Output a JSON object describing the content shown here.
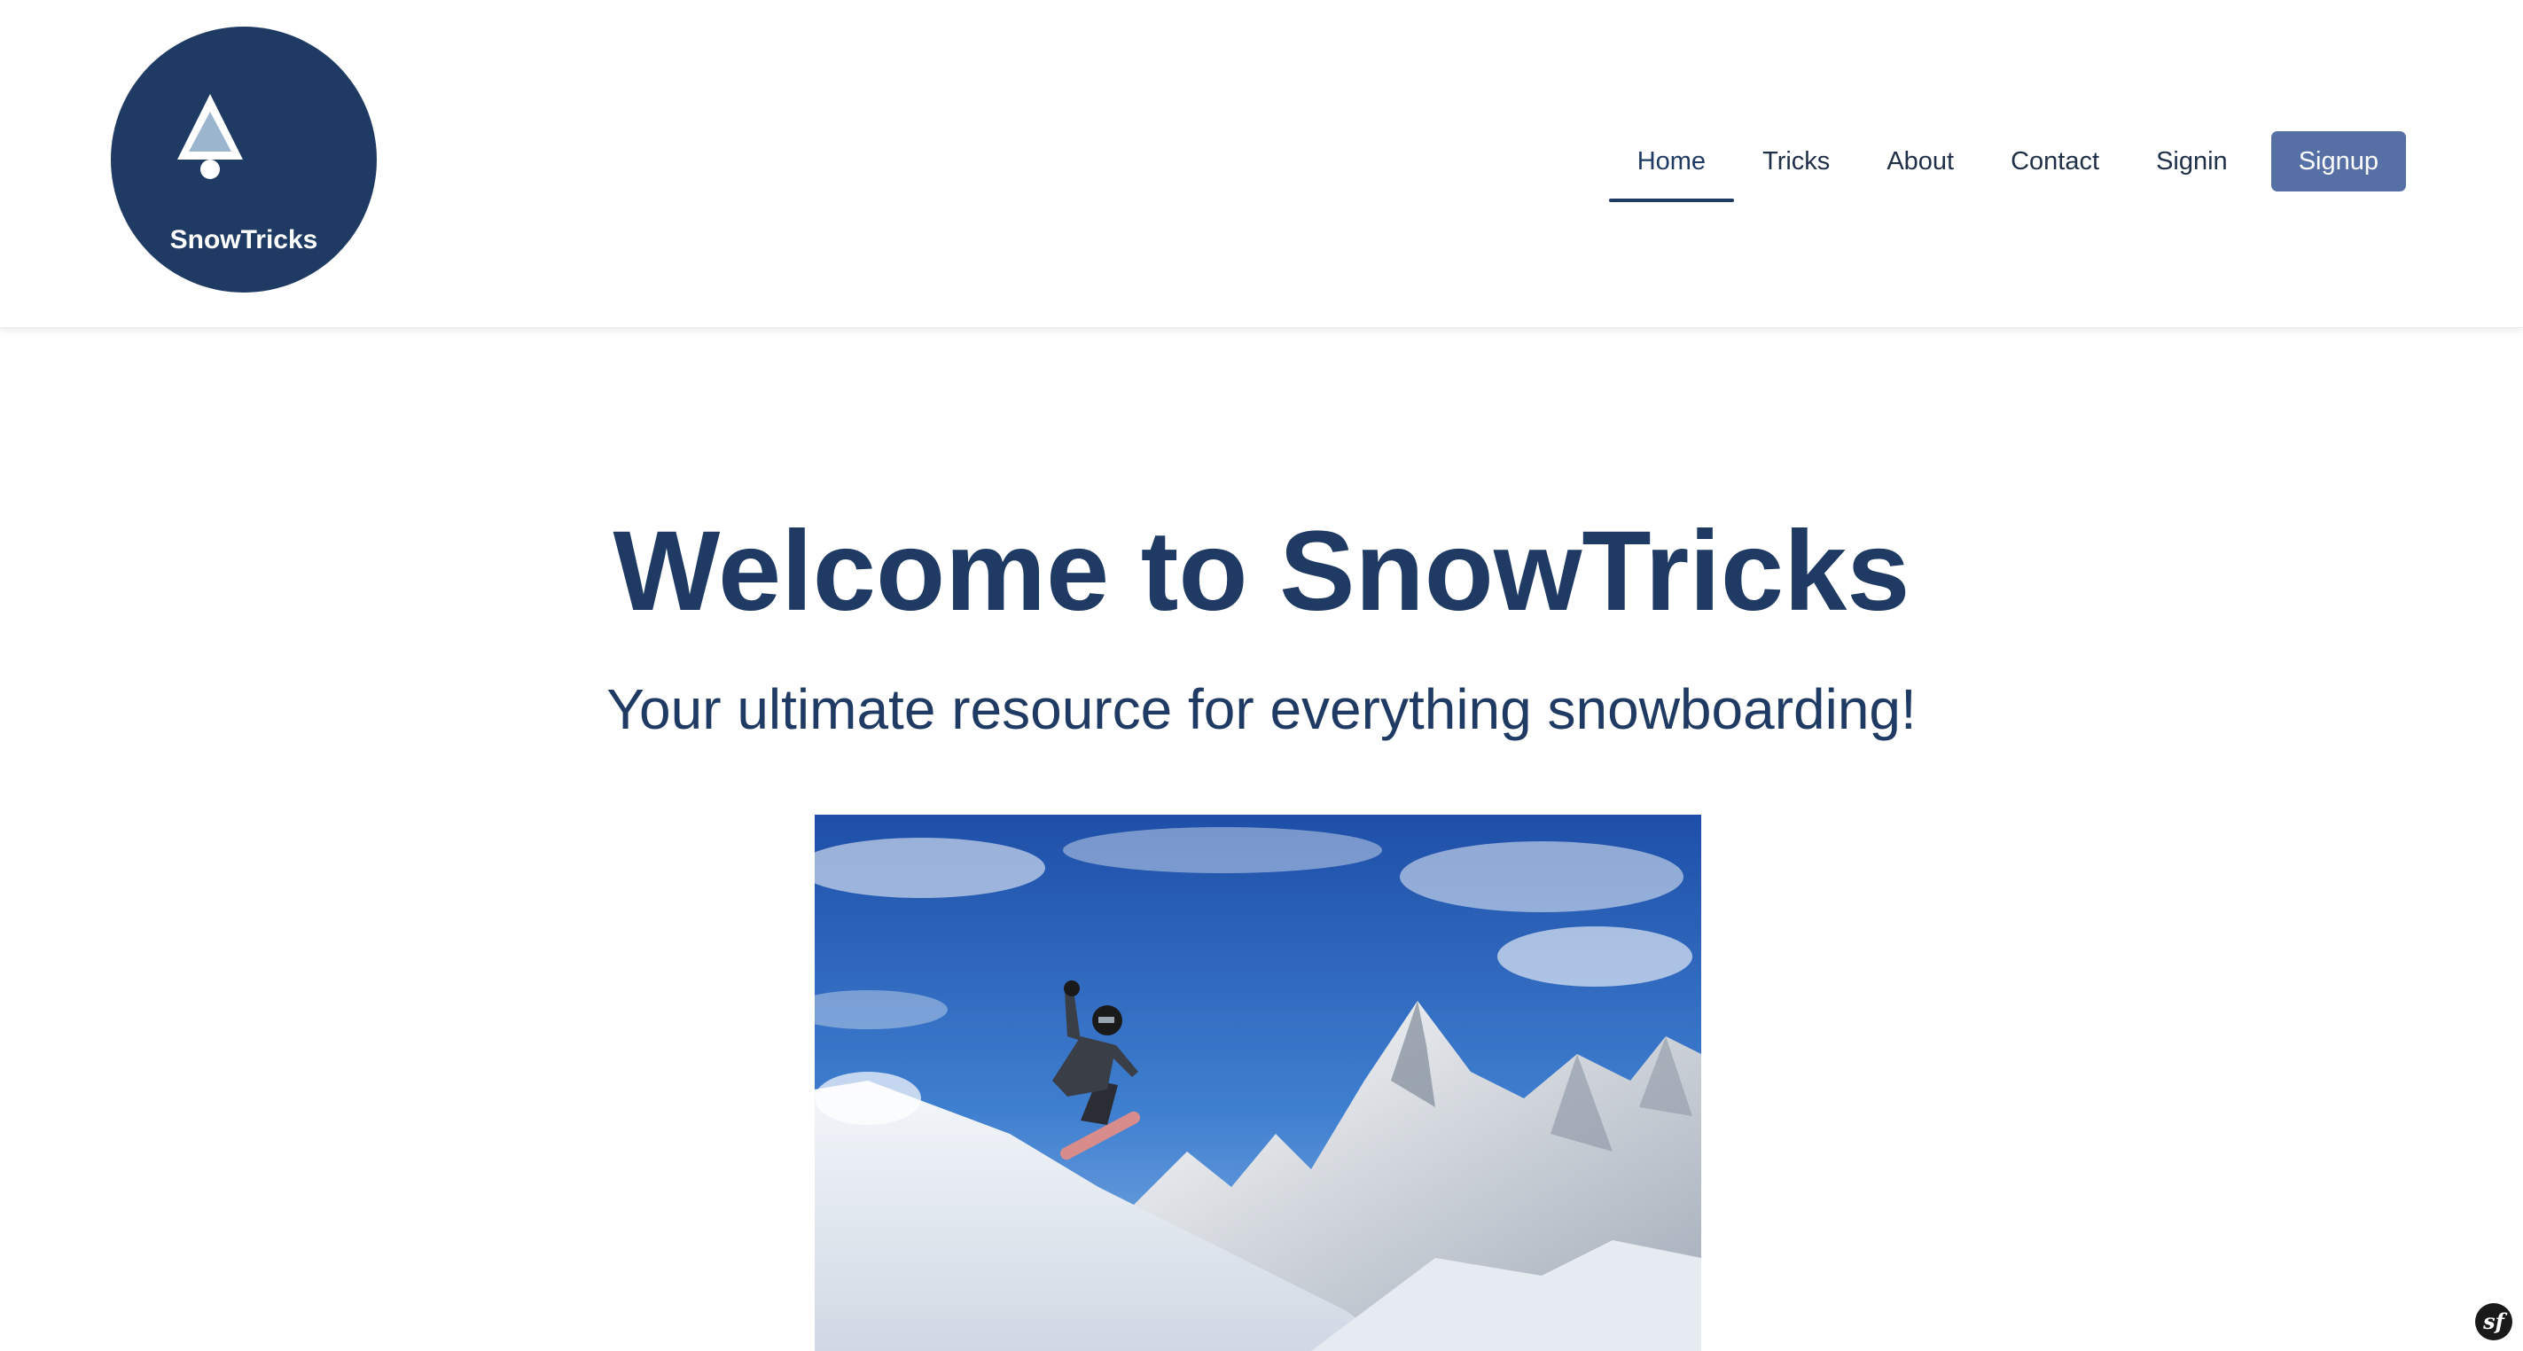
{
  "brand": {
    "name": "SnowTricks",
    "logo_icon": "tree-icon",
    "logo_color": "#1f3b63"
  },
  "nav": {
    "items": [
      {
        "label": "Home",
        "active": true
      },
      {
        "label": "Tricks",
        "active": false
      },
      {
        "label": "About",
        "active": false
      },
      {
        "label": "Contact",
        "active": false
      },
      {
        "label": "Signin",
        "active": false
      }
    ],
    "signup_label": "Signup",
    "signup_color": "#5670a6"
  },
  "hero": {
    "title": "Welcome to SnowTricks",
    "subtitle": "Your ultimate resource for everything snowboarding!",
    "image_subject": "snowboarder-jump-mountain-image"
  },
  "debug_toolbar": {
    "icon": "symfony-icon",
    "glyph": "sf"
  },
  "colors": {
    "primary": "#1f3b63",
    "accent": "#5670a6",
    "text": "#1f2f48"
  }
}
